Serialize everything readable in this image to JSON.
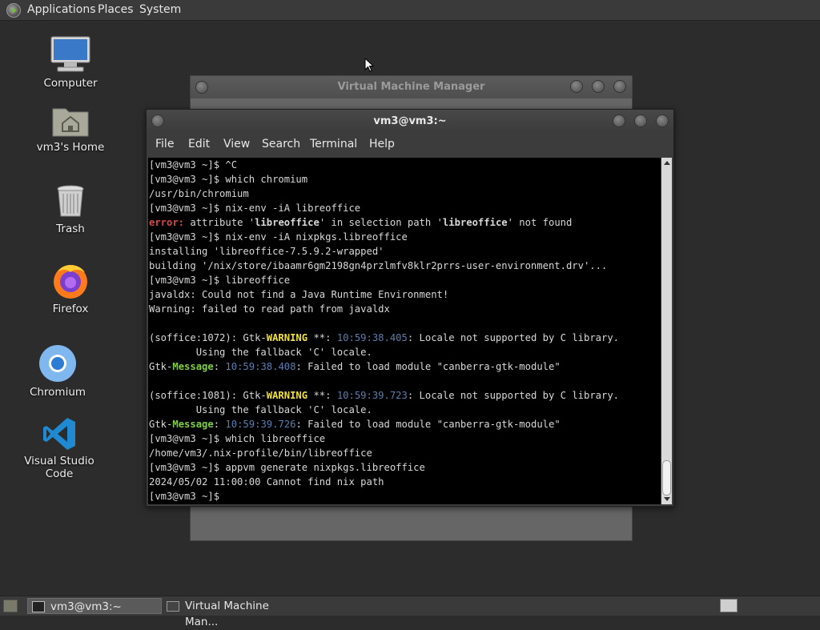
{
  "top_panel": {
    "menus": [
      "Applications",
      "Places",
      "System"
    ]
  },
  "desktop_icons": [
    {
      "label": "Computer",
      "icon": "computer-icon"
    },
    {
      "label": "vm3's Home",
      "icon": "home-folder-icon"
    },
    {
      "label": "Trash",
      "icon": "trash-icon"
    },
    {
      "label": "Firefox",
      "icon": "firefox-icon"
    },
    {
      "label": "Chromium",
      "icon": "chromium-icon"
    },
    {
      "label": "Visual Studio Code",
      "icon": "vscode-icon"
    }
  ],
  "vm_manager": {
    "title": "Virtual Machine Manager"
  },
  "terminal": {
    "title": "vm3@vm3:~",
    "menus": [
      "File",
      "Edit",
      "View",
      "Search",
      "Terminal",
      "Help"
    ],
    "lines": [
      "[vm3@vm3 ~]$ ^C",
      "[vm3@vm3 ~]$ which chromium",
      "/usr/bin/chromium",
      "[vm3@vm3 ~]$ nix-env -iA libreoffice",
      "error: attribute 'libreoffice' in selection path 'libreoffice' not found",
      "[vm3@vm3 ~]$ nix-env -iA nixpkgs.libreoffice",
      "installing 'libreoffice-7.5.9.2-wrapped'",
      "building '/nix/store/ibaamr6gm2198gn4przlmfv8klr2prrs-user-environment.drv'...",
      "[vm3@vm3 ~]$ libreoffice",
      "javaldx: Could not find a Java Runtime Environment!",
      "Warning: failed to read path from javaldx",
      "",
      "(soffice:1072): Gtk-WARNING **: 10:59:38.405: Locale not supported by C library.",
      "        Using the fallback 'C' locale.",
      "Gtk-Message: 10:59:38.408: Failed to load module \"canberra-gtk-module\"",
      "",
      "(soffice:1081): Gtk-WARNING **: 10:59:39.723: Locale not supported by C library.",
      "        Using the fallback 'C' locale.",
      "Gtk-Message: 10:59:39.726: Failed to load module \"canberra-gtk-module\"",
      "[vm3@vm3 ~]$ which libreoffice",
      "/home/vm3/.nix-profile/bin/libreoffice",
      "[vm3@vm3 ~]$ appvm generate nixpkgs.libreoffice",
      "2024/05/02 11:00:00 Cannot find nix path",
      "[vm3@vm3 ~]$ "
    ]
  },
  "taskbar": {
    "tasks": [
      {
        "label": "vm3@vm3:~",
        "active": true
      },
      {
        "label": "Virtual Machine Man...",
        "active": false
      }
    ]
  }
}
